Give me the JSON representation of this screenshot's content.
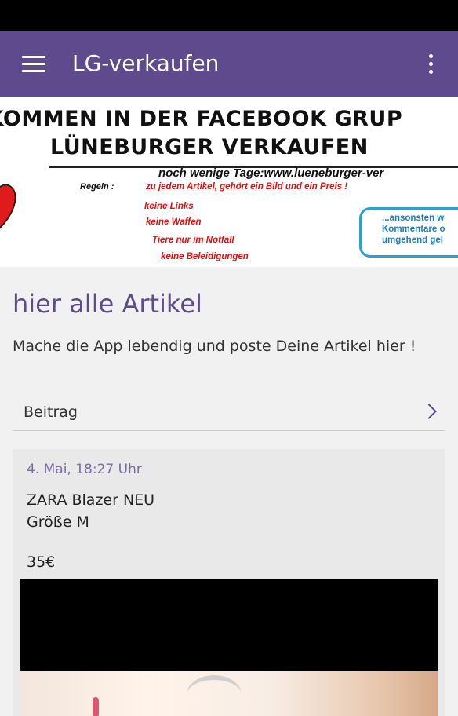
{
  "app_bar": {
    "title": "LG-verkaufen",
    "menu_icon": "hamburger-menu-icon",
    "overflow_icon": "more-vert-icon",
    "color": "#5e4a8c"
  },
  "banner": {
    "line1": "LKOMMEN IN DER FACEBOOK GRUP",
    "line2": "LÜNEBURGER VERKAUFEN",
    "line3": "noch wenige Tage:www.lueneburger-ver",
    "regeln_label": "Regeln :",
    "rule1": "zu jedem Artikel, gehört ein Bild und ein Preis !",
    "rule2": "keine Links",
    "rule3": "keine Waffen",
    "rule4": "Tiere nur im Notfall",
    "rule5": "keine Beleidigungen",
    "box_line1": "...ansonsten w",
    "box_line2": "Kommentare o",
    "box_line3": "umgehend gel"
  },
  "section": {
    "title": "hier alle Artikel",
    "description": "Mache die App lebendig und poste Deine Artikel hier !"
  },
  "beitrag": {
    "label": "Beitrag",
    "chevron_icon": "chevron-right-icon"
  },
  "post": {
    "date": "4. Mai, 18:27 Uhr",
    "title": "ZARA Blazer NEU\nGröße M",
    "price": "35€"
  }
}
